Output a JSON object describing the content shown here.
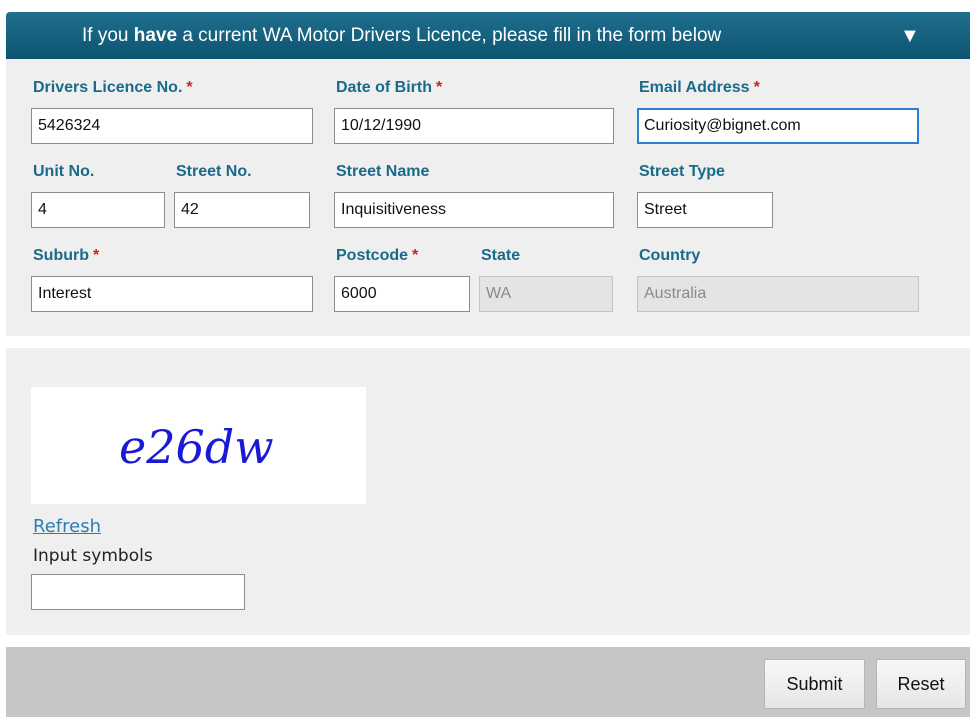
{
  "banner": {
    "text_before": "If you ",
    "text_bold": "have",
    "text_after": " a current WA Motor Drivers Licence, please fill in the form below",
    "arrow": "▼"
  },
  "form": {
    "licence": {
      "label": "Drivers Licence No.",
      "value": "5426324"
    },
    "dob": {
      "label": "Date of Birth",
      "value": "10/12/1990"
    },
    "email": {
      "label": "Email Address",
      "value": "Curiosity@bignet.com"
    },
    "unit": {
      "label": "Unit No.",
      "value": "4"
    },
    "street_no": {
      "label": "Street No.",
      "value": "42"
    },
    "street_name": {
      "label": "Street Name",
      "value": "Inquisitiveness"
    },
    "street_type": {
      "label": "Street Type",
      "value": "Street"
    },
    "suburb": {
      "label": "Suburb",
      "value": "Interest"
    },
    "postcode": {
      "label": "Postcode",
      "value": "6000"
    },
    "state": {
      "label": "State",
      "value": "WA"
    },
    "country": {
      "label": "Country",
      "value": "Australia"
    },
    "required_mark": "*"
  },
  "captcha": {
    "image_text": "e26dw",
    "image_color": "#1a1ad4",
    "refresh_label": "Refresh",
    "input_label": "Input symbols",
    "input_value": ""
  },
  "footer": {
    "submit_label": "Submit",
    "reset_label": "Reset"
  },
  "colors": {
    "banner": "#0d5470",
    "label": "#1a6a8a",
    "required": "#d0201f",
    "link": "#2a7fb0"
  }
}
